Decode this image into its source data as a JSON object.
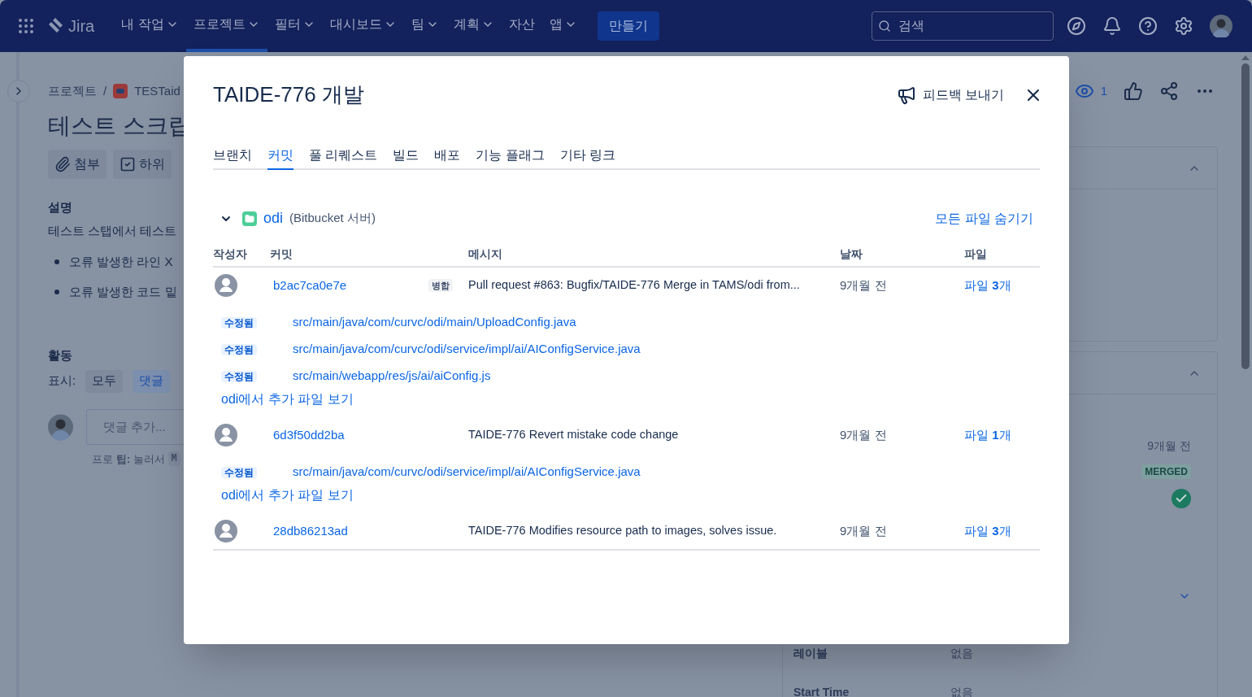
{
  "nav": {
    "product": "Jira",
    "items": [
      {
        "label": "내 작업",
        "dropdown": true,
        "selected": false
      },
      {
        "label": "프로젝트",
        "dropdown": true,
        "selected": true
      },
      {
        "label": "필터",
        "dropdown": true,
        "selected": false
      },
      {
        "label": "대시보드",
        "dropdown": true,
        "selected": false
      },
      {
        "label": "팀",
        "dropdown": true,
        "selected": false
      },
      {
        "label": "계획",
        "dropdown": true,
        "selected": false
      },
      {
        "label": "자산",
        "dropdown": false,
        "selected": false
      },
      {
        "label": "앱",
        "dropdown": true,
        "selected": false
      }
    ],
    "create_button": "만들기",
    "search": {
      "placeholder": "검색"
    }
  },
  "breadcrumb": [
    "프로젝트",
    "TESTaid"
  ],
  "breadcrumb_separator": "/",
  "issue": {
    "title": "테스트 스크립",
    "actions": [
      "첨부",
      "하위"
    ],
    "description_heading": "설명",
    "description": "테스트 스탭에서 테스트",
    "bullets": [
      "오류 발생한 라인 X",
      "오류 발생한 코드 밑"
    ],
    "activity_heading": "활동",
    "show_label": "표시:",
    "filters": [
      {
        "label": "모두",
        "selected": false
      },
      {
        "label": "댓글",
        "selected": true
      }
    ],
    "comment": {
      "placeholder": "댓글 추가..."
    },
    "pro_tip": "프로 **팁:** 눌러서",
    "pro_tip_key": "M"
  },
  "watchers": {
    "count": "1"
  },
  "side_panel": {
    "pr_date": "9개월 전",
    "pr_status": "MERGED",
    "fields": [
      {
        "label": "레이블",
        "value": "없음"
      },
      {
        "label": "Start Time",
        "value": "없음"
      }
    ]
  },
  "dialog": {
    "title": "TAIDE-776 개발",
    "feedback_button": "피드백 보내기",
    "tabs": [
      {
        "label": "브랜치",
        "selected": false
      },
      {
        "label": "커밋",
        "selected": true
      },
      {
        "label": "풀 리퀘스트",
        "selected": false
      },
      {
        "label": "빌드",
        "selected": false
      },
      {
        "label": "배포",
        "selected": false
      },
      {
        "label": "기능 플래그",
        "selected": false
      },
      {
        "label": "기타 링크",
        "selected": false
      }
    ],
    "repository": {
      "name": "odi",
      "host": "(Bitbucket 서버)",
      "expanded": true,
      "hide_all": "모든 파일 숨기기"
    },
    "columns": [
      "작성자",
      "커밋",
      "메시지",
      "날짜",
      "파일"
    ],
    "commits": [
      {
        "hash": "b2ac7ca0e7e",
        "badge": "병합",
        "message": "Pull request #863: Bugfix/TAIDE-776 Merge in TAMS/odi from...",
        "date": "9개월 전",
        "files_link": "파일 **3**개",
        "files": [
          {
            "status": "수정됨",
            "path": "src/main/java/com/curvc/odi/main/UploadConfig.java"
          },
          {
            "status": "수정됨",
            "path": "src/main/java/com/curvc/odi/service/impl/ai/AIConfigService.java"
          },
          {
            "status": "수정됨",
            "path": "src/main/webapp/res/js/ai/aiConfig.js"
          }
        ],
        "more_link": "odi에서 추가 파일 보기"
      },
      {
        "hash": "6d3f50dd2ba",
        "message": "TAIDE-776 Revert mistake code change",
        "date": "9개월 전",
        "files_link": "파일 **1**개",
        "files": [
          {
            "status": "수정됨",
            "path": "src/main/java/com/curvc/odi/service/impl/ai/AIConfigService.java"
          }
        ],
        "more_link": "odi에서 추가 파일 보기"
      },
      {
        "hash": "28db86213ad",
        "message": "TAIDE-776 Modifies resource path to images, solves issue.",
        "date": "9개월 전",
        "files_link": "파일 **3**개"
      }
    ]
  }
}
